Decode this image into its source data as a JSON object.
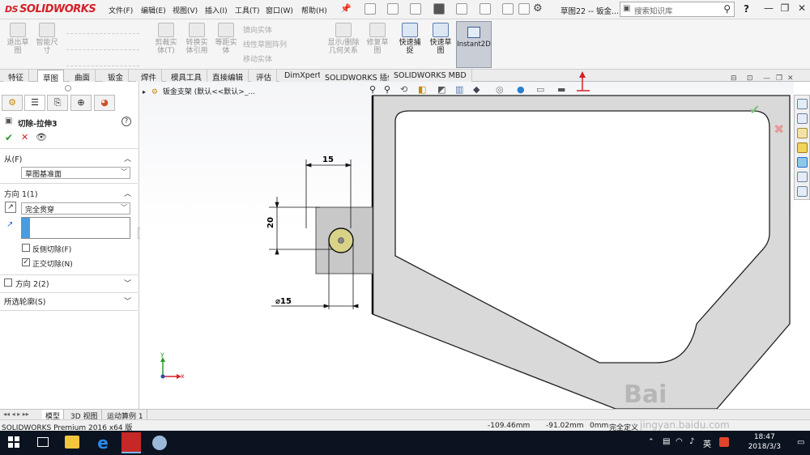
{
  "app": {
    "brand": "SOLIDWORKS",
    "menus": [
      "文件(F)",
      "编辑(E)",
      "视图(V)",
      "插入(I)",
      "工具(T)",
      "窗口(W)",
      "帮助(H)"
    ],
    "document_title": "草图22 -- 钣金...",
    "search_placeholder": "搜索知识库",
    "help_label": "?",
    "window_controls": [
      "minimize-icon",
      "restore-icon",
      "close-icon"
    ]
  },
  "ribbon": {
    "buttons": [
      {
        "label": "退出草\n图",
        "enabled": false
      },
      {
        "label": "智能尺\n寸",
        "enabled": false
      },
      {
        "label": "剪裁实\n体(T)",
        "enabled": false
      },
      {
        "label": "转换实\n体引用",
        "enabled": false
      },
      {
        "label": "等距实\n体",
        "enabled": false
      },
      {
        "label": "显示/删除\n几何关系",
        "enabled": false
      },
      {
        "label": "修复草\n图",
        "enabled": false
      },
      {
        "label": "快速捕\n捉",
        "enabled": true
      },
      {
        "label": "快速草\n图",
        "enabled": true
      },
      {
        "label": "Instant2D",
        "enabled": true,
        "active": true
      }
    ],
    "small_items": [
      "镜向实体",
      "线性草图阵列",
      "移动实体"
    ]
  },
  "command_tabs": [
    "特征",
    "草图",
    "曲面",
    "钣金",
    "焊件",
    "模具工具",
    "直接编辑",
    "评估",
    "DimXpert",
    "SOLIDWORKS 插件",
    "SOLIDWORKS MBD"
  ],
  "active_command_tab": "草图",
  "property_manager": {
    "title": "切除-拉伸3",
    "help": "?",
    "from_label": "从(F)",
    "from_value": "草图基准面",
    "direction1_label": "方向 1(1)",
    "direction1_end": "完全贯穿",
    "direction1_depth": "",
    "flip_side_label": "反侧切除(F)",
    "flip_side_checked": false,
    "normal_cut_label": "正交切除(N)",
    "normal_cut_checked": true,
    "direction2_label": "方向 2(2)",
    "direction2_checked": false,
    "selected_contours_label": "所选轮廓(S)"
  },
  "viewport": {
    "breadcrumb": "钣金支架 (默认<<默认>_...",
    "dimensions": {
      "horizontal": "15",
      "vertical": "20",
      "diameter": "⌀15"
    },
    "triad": {
      "x": "x",
      "y": "y"
    }
  },
  "bottom_tabs": [
    "模型",
    "3D 视图",
    "运动算例 1"
  ],
  "active_bottom_tab": "模型",
  "status_bar": {
    "product": "SOLIDWORKS Premium 2016 x64 版",
    "x_coord": "-109.46mm",
    "y_coord": "-91.02mm",
    "z_coord": "0mm",
    "state": "完全定义"
  },
  "taskbar": {
    "ime": "英",
    "time": "18:47",
    "date": "2018/3/3"
  },
  "watermark": {
    "text": "Bai",
    "url": "jingyan.baidu.com"
  },
  "colors": {
    "brand_red": "#d42027",
    "part_fill": "#d9d9d9",
    "cutout_fill": "#c8c8c8",
    "circle_fill": "#d9d38a",
    "taskbar": "#0b1320"
  }
}
